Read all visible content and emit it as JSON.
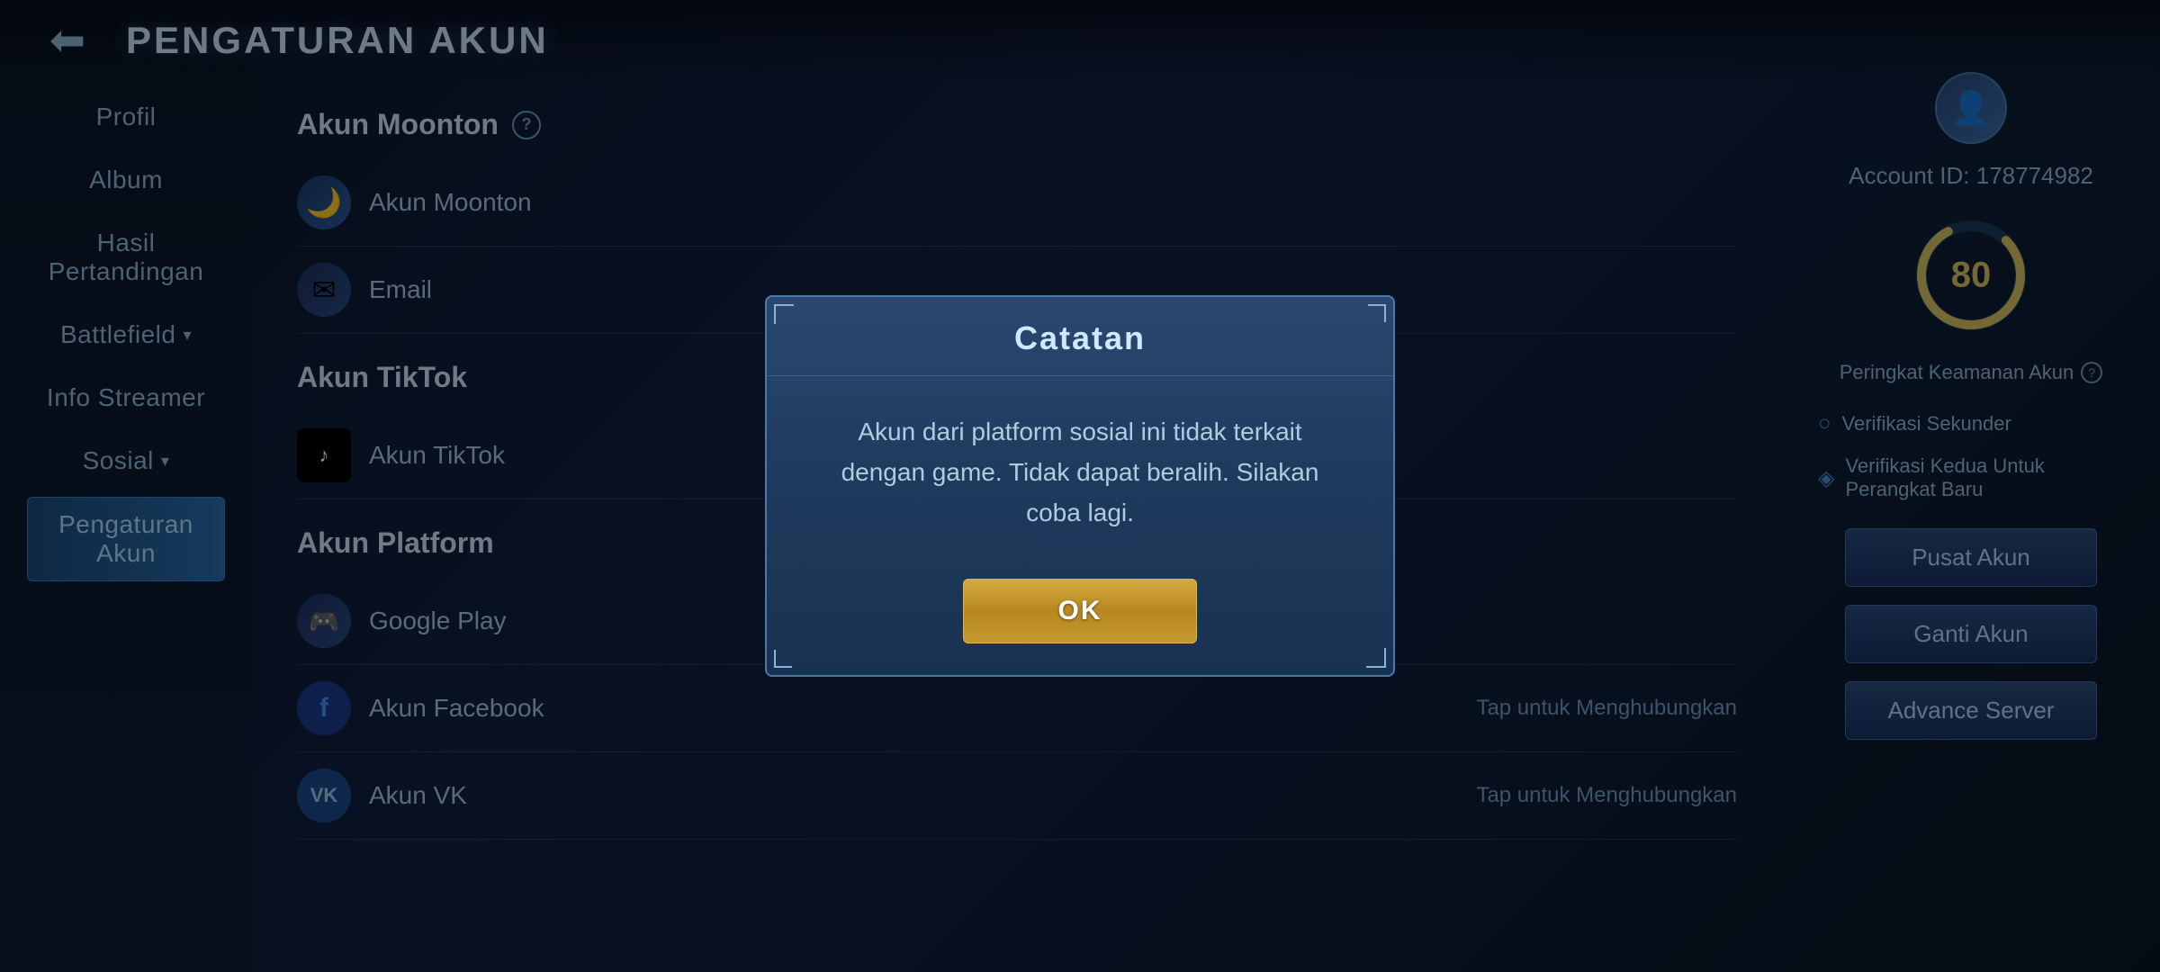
{
  "header": {
    "title": "PENGATURAN AKUN",
    "back_label": "←"
  },
  "sidebar": {
    "items": [
      {
        "id": "profil",
        "label": "Profil",
        "active": false
      },
      {
        "id": "album",
        "label": "Album",
        "active": false
      },
      {
        "id": "hasil-pertandingan",
        "label": "Hasil Pertandingan",
        "active": false
      },
      {
        "id": "battlefield",
        "label": "Battlefield",
        "active": false,
        "hasArrow": true
      },
      {
        "id": "info-streamer",
        "label": "Info Streamer",
        "active": false
      },
      {
        "id": "sosial",
        "label": "Sosial",
        "active": false,
        "hasArrow": true
      },
      {
        "id": "pengaturan-akun",
        "label": "Pengaturan Akun",
        "active": true
      }
    ]
  },
  "main": {
    "akun_moonton": {
      "title": "Akun Moonton",
      "rows": [
        {
          "icon": "🌙",
          "iconType": "moon",
          "label": "Akun Moonton"
        },
        {
          "icon": "✉",
          "iconType": "email",
          "label": "Email"
        }
      ]
    },
    "akun_tiktok": {
      "title": "Akun TikTok",
      "rows": [
        {
          "icon": "♪",
          "iconType": "tiktok",
          "label": "Akun TikTok"
        }
      ]
    },
    "akun_platform": {
      "title": "Akun Platform",
      "rows": [
        {
          "icon": "🎮",
          "iconType": "google",
          "label": "Google Play"
        },
        {
          "icon": "f",
          "iconType": "facebook",
          "label": "Akun Facebook",
          "value": "Tap untuk Menghubungkan"
        },
        {
          "icon": "VK",
          "iconType": "vk",
          "label": "Akun VK",
          "value": "Tap untuk Menghubungkan"
        }
      ]
    }
  },
  "right_panel": {
    "account_id_label": "Account ID:",
    "account_id_value": "178774982",
    "security_score": "80",
    "security_label": "Peringkat Keamanan Akun",
    "security_options": [
      {
        "label": "Verifikasi Sekunder",
        "checked": false
      },
      {
        "label": "Verifikasi Kedua Untuk Perangkat Baru",
        "checked": true
      }
    ],
    "buttons": [
      {
        "id": "pusat-akun",
        "label": "Pusat Akun"
      },
      {
        "id": "ganti-akun",
        "label": "Ganti Akun"
      },
      {
        "id": "advance-server",
        "label": "Advance Server"
      }
    ]
  },
  "modal": {
    "title": "Catatan",
    "message": "Akun dari platform sosial ini tidak terkait dengan game. Tidak dapat beralih. Silakan coba lagi.",
    "ok_label": "OK"
  }
}
